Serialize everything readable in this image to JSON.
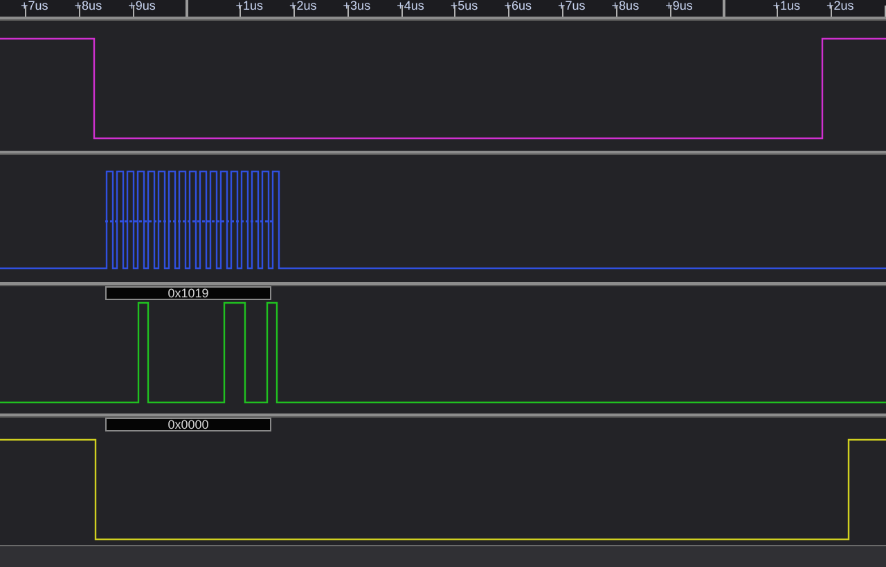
{
  "ruler": {
    "ticks": [
      {
        "kind": "minor",
        "label": "+7us"
      },
      {
        "kind": "minor",
        "label": "+8us"
      },
      {
        "kind": "minor",
        "label": "+9us"
      },
      {
        "kind": "major"
      },
      {
        "kind": "minor",
        "label": "+1us"
      },
      {
        "kind": "minor",
        "label": "+2us"
      },
      {
        "kind": "minor",
        "label": "+3us"
      },
      {
        "kind": "minor",
        "label": "+4us"
      },
      {
        "kind": "minor",
        "label": "+5us"
      },
      {
        "kind": "minor",
        "label": "+6us"
      },
      {
        "kind": "minor",
        "label": "+7us"
      },
      {
        "kind": "minor",
        "label": "+8us"
      },
      {
        "kind": "minor",
        "label": "+9us"
      },
      {
        "kind": "major"
      },
      {
        "kind": "minor",
        "label": "+1us"
      },
      {
        "kind": "minor",
        "label": "+2us"
      },
      {
        "kind": "minor"
      }
    ]
  },
  "channels": [
    {
      "color": "#d030d0"
    },
    {
      "color": "#3050e0"
    },
    {
      "color": "#20c020",
      "bus_label": "0x1019"
    },
    {
      "color": "#d0d020",
      "bus_label": "0x0000"
    }
  ]
}
